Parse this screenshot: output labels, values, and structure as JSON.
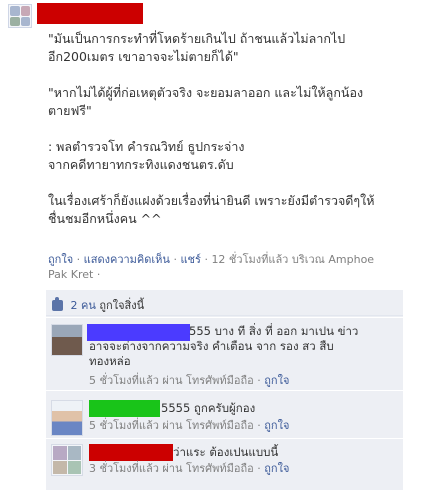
{
  "post": {
    "text": "\"มันเป็นการกระทำที่โหดร้ายเกินไป ถ้าชนแล้วไม่ลากไป\nอีก200เมตร เขาอาจจะไม่ตายก็ได้\"\n\n\"หากไม่ได้ผู้ที่ก่อเหตุตัวจริง จะยอมลาออก และไม่ให้ลูกน้อง\nตายฟรี\"\n\n: พลตำรวจโท คำรณวิทย์ ธูปกระจ่าง\nจากคดีทายาทกระทิงแดงชนตร.ดับ\n\nในเรื่องเศร้าก็ยังแฝงด้วยเรื่องที่น่ายินดี เพราะยังมีตำรวจดีๆให้\nชื่นชมอีกหนึ่งคน ^^"
  },
  "actions": {
    "like": "ถูกใจ",
    "comment": "แสดงความคิดเห็น",
    "share": "แชร์",
    "sep": "·",
    "time_location": "12 ชั่วโมงที่แล้ว บริเวณ Amphoe",
    "location_2": "Pak Kret",
    "sep_tail": "·"
  },
  "likes": {
    "count_label": "2 คน",
    "suffix": "ถูกใจสิ่งนี้"
  },
  "comments": [
    {
      "text_line1": "555 บาง ที สิ่ง ที่ ออก มาเปน ข่าว",
      "text_rest": "อาจจะต่างจากความจริง คำเตือน จาก รอง สว สืบ\nทองหล่อ",
      "time": "5 ชั่วโมงที่แล้ว ผ่าน โทรศัพท์มือถือ",
      "sep": "·",
      "like": "ถูกใจ",
      "redact_color": "#4b3bff"
    },
    {
      "text_line1": "5555 ถูกครับผู้กอง",
      "time": "5 ชั่วโมงที่แล้ว ผ่าน โทรศัพท์มือถือ",
      "sep": "·",
      "like": "ถูกใจ",
      "redact_color": "#19c419"
    },
    {
      "text_line1": "ว่าแระ ต้องเปนแบบนี้",
      "time": "3 ชั่วโมงที่แล้ว ผ่าน โทรศัพท์มือถือ",
      "sep": "·",
      "like": "ถูกใจ",
      "redact_color": "#cc0000"
    }
  ],
  "colors": {
    "link": "#3b5998",
    "meta": "#808080",
    "panel": "#edeff4",
    "name_redact": "#cc0000"
  }
}
